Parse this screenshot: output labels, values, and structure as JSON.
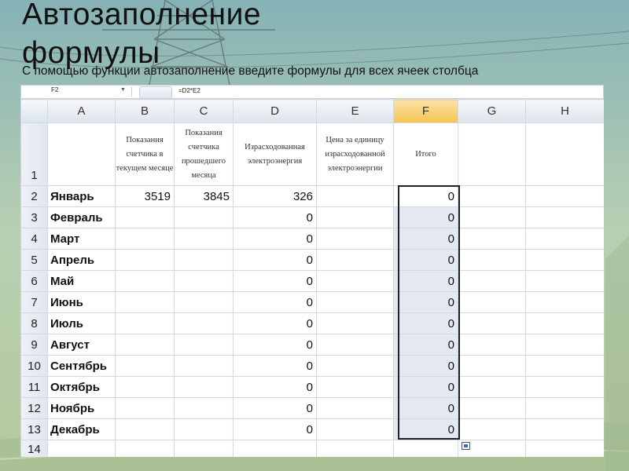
{
  "slide": {
    "title_line1": "Автозаполнение",
    "title_line2": "формулы",
    "subtitle": "С помощью функции автозаполнение введите формулы для всех ячеек столбца"
  },
  "formula_bar": {
    "name_box": "F2",
    "formula": "=D2*E2"
  },
  "columns": [
    "A",
    "B",
    "C",
    "D",
    "E",
    "F",
    "G",
    "H"
  ],
  "selected_column": "F",
  "header_row": {
    "row_number": "1",
    "B": "Показания счетчика в текущем месяце",
    "C": "Показания счетчика прошедшего месяца",
    "D": "Израсходованная электроэнергия",
    "E": "Цена за единицу израсходованной электроэнергии",
    "F": "Итого"
  },
  "rows": [
    {
      "n": "2",
      "month": "Январь",
      "B": "3519",
      "C": "3845",
      "D": "326",
      "F": "0"
    },
    {
      "n": "3",
      "month": "Февраль",
      "B": "",
      "C": "",
      "D": "0",
      "F": "0"
    },
    {
      "n": "4",
      "month": "Март",
      "B": "",
      "C": "",
      "D": "0",
      "F": "0"
    },
    {
      "n": "5",
      "month": "Апрель",
      "B": "",
      "C": "",
      "D": "0",
      "F": "0"
    },
    {
      "n": "6",
      "month": "Май",
      "B": "",
      "C": "",
      "D": "0",
      "F": "0"
    },
    {
      "n": "7",
      "month": "Июнь",
      "B": "",
      "C": "",
      "D": "0",
      "F": "0"
    },
    {
      "n": "8",
      "month": "Июль",
      "B": "",
      "C": "",
      "D": "0",
      "F": "0"
    },
    {
      "n": "9",
      "month": "Август",
      "B": "",
      "C": "",
      "D": "0",
      "F": "0"
    },
    {
      "n": "10",
      "month": "Сентябрь",
      "B": "",
      "C": "",
      "D": "0",
      "F": "0"
    },
    {
      "n": "11",
      "month": "Октябрь",
      "B": "",
      "C": "",
      "D": "0",
      "F": "0"
    },
    {
      "n": "12",
      "month": "Ноябрь",
      "B": "",
      "C": "",
      "D": "0",
      "F": "0"
    },
    {
      "n": "13",
      "month": "Декабрь",
      "B": "",
      "C": "",
      "D": "0",
      "F": "0"
    }
  ],
  "last_row_number": "14",
  "icons": {
    "fill_handle": "autofill-options-icon"
  }
}
